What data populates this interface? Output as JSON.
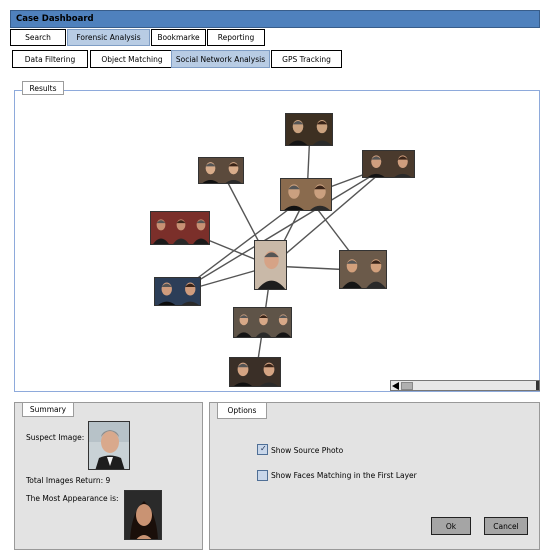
{
  "window": {
    "title": "Case Dashboard"
  },
  "main_tabs": [
    {
      "label": "Search",
      "active": false
    },
    {
      "label": "Forensic Analysis",
      "active": true
    },
    {
      "label": "Bookmarke",
      "active": false
    },
    {
      "label": "Reporting",
      "active": false
    }
  ],
  "sub_tabs": [
    {
      "label": "Data Filtering",
      "active": false
    },
    {
      "label": "Object Matching",
      "active": false
    },
    {
      "label": "Social Network Analysis",
      "active": true
    },
    {
      "label": "GPS Tracking",
      "active": false
    }
  ],
  "results": {
    "label": "Results",
    "node_count": 11,
    "edges": [
      [
        0,
        1
      ],
      [
        0,
        2
      ],
      [
        0,
        3
      ],
      [
        0,
        4
      ],
      [
        0,
        6
      ],
      [
        0,
        7
      ],
      [
        0,
        9
      ],
      [
        1,
        4
      ],
      [
        1,
        5
      ],
      [
        1,
        6
      ],
      [
        1,
        8
      ],
      [
        4,
        7
      ],
      [
        9,
        10
      ]
    ]
  },
  "summary": {
    "label": "Summary",
    "suspect_label": "Suspect Image:",
    "total_label": "Total Images Return: 9",
    "most_label": "The Most Appearance is:"
  },
  "options": {
    "label": "Options",
    "show_source_label": "Show Source Photo",
    "show_source_checked": true,
    "show_faces_label": "Show Faces Matching in the First Layer",
    "show_faces_checked": false,
    "ok_label": "Ok",
    "cancel_label": "Cancel"
  },
  "colors": {
    "titlebar": "#4f81bd",
    "active_tab": "#b8cce4",
    "panel_bg": "#e3e3e3",
    "results_border": "#8eaadb"
  }
}
